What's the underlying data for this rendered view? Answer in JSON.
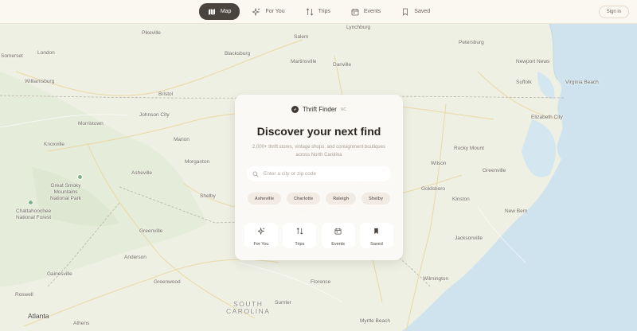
{
  "nav": {
    "items": [
      {
        "label": "Map",
        "icon": "map-icon",
        "active": true
      },
      {
        "label": "For You",
        "icon": "sparkle-icon",
        "active": false
      },
      {
        "label": "Trips",
        "icon": "route-icon",
        "active": false
      },
      {
        "label": "Events",
        "icon": "calendar-icon",
        "active": false
      },
      {
        "label": "Saved",
        "icon": "bookmark-icon",
        "active": false
      }
    ],
    "sign_in": "Sign in"
  },
  "card": {
    "brand": "Thrift Finder",
    "badge": "NC",
    "headline": "Discover your next find",
    "subtitle": "2,000+ thrift stores, vintage shops, and consignment boutiques across North Carolina",
    "search_placeholder": "Enter a city or zip code",
    "chips": [
      "Asheville",
      "Charlotte",
      "Raleigh",
      "Shelby"
    ],
    "tiles": [
      {
        "label": "For You",
        "icon": "sparkle-icon"
      },
      {
        "label": "Trips",
        "icon": "route-icon"
      },
      {
        "label": "Events",
        "icon": "calendar-icon"
      },
      {
        "label": "Saved",
        "icon": "bookmark-icon"
      }
    ]
  },
  "map": {
    "labels": {
      "somerset": "Somerset",
      "london": "London",
      "williamsburg": "Williamsburg",
      "pikeville": "Pikeville",
      "bristol": "Bristol",
      "johnson_city": "Johnson City",
      "morristown": "Morristown",
      "knoxville": "Knoxville",
      "great_smoky": "Great Smoky\nMountains\nNational Park",
      "chattahoochee": "Chattahoochee\nNational Forest",
      "asheville": "Asheville",
      "morganton": "Morganton",
      "shelby": "Shelby",
      "greenville": "Greenville",
      "anderson": "Anderson",
      "gainesville": "Gainesville",
      "roswell": "Roswell",
      "atlanta": "Atlanta",
      "athens": "Athens",
      "greenwood": "Greenwood",
      "salem": "Salem",
      "lynchburg": "Lynchburg",
      "martinsville": "Martinsville",
      "danville": "Danville",
      "petersburg": "Petersburg",
      "newport_news": "Newport News",
      "suffolk": "Suffolk",
      "virginia_beach": "Virginia Beach",
      "elizabeth_city": "Elizabeth City",
      "rocky_mount": "Rocky Mount",
      "wilson": "Wilson",
      "greenville_nc": "Greenville",
      "goldsboro": "Goldsboro",
      "kinston": "Kinston",
      "new_bern": "New Bern",
      "jacksonville": "Jacksonville",
      "wilmington": "Wilmington",
      "florence": "Florence",
      "sumter": "Sumter",
      "myrtle_beach": "Myrtle Beach",
      "south_carolina": "SOUTH\nCAROLINA",
      "blacksburg": "Blacksburg",
      "marion": "Marion"
    }
  }
}
